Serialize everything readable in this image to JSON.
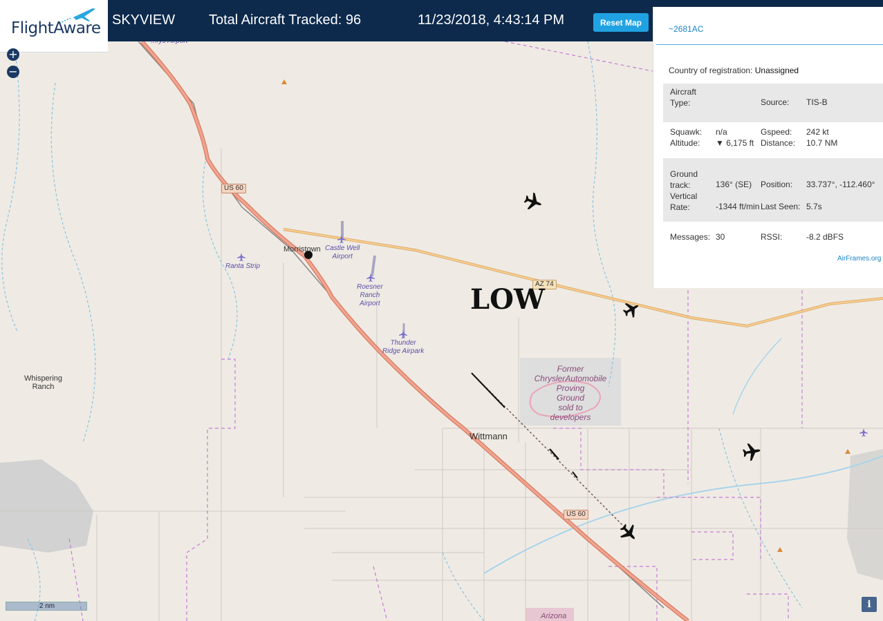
{
  "header": {
    "logo_text": "FlightAware",
    "title": "SKYVIEW",
    "total_aircraft": "Total Aircraft Tracked: 96",
    "datetime": "11/23/2018, 4:43:14 PM",
    "reset_button": "Reset Map"
  },
  "zoom": {
    "in": "+",
    "out": "−"
  },
  "panel": {
    "title": "~2681AC",
    "country_label": "Country of registration:",
    "country_value": "Unassigned",
    "aircraft_type_label": "Aircraft\nType:",
    "source_label": "Source:",
    "source_value": "TIS-B",
    "squawk_label": "Squawk:",
    "squawk_value": "n/a",
    "gspeed_label": "Gspeed:",
    "gspeed_value": "242 kt",
    "altitude_label": "Altitude:",
    "altitude_value": "▼ 6,175 ft",
    "distance_label": "Distance:",
    "distance_value": "10.7 NM",
    "ground_track_label": "Ground\ntrack:",
    "ground_track_value": "136° (SE)",
    "position_label": "Position:",
    "position_value": "33.737°, -112.460°",
    "vertical_rate_label": "Vertical\nRate:",
    "vertical_rate_value": "-1344 ft/min",
    "last_seen_label": "Last Seen:",
    "last_seen_value": "5.7s",
    "messages_label": "Messages:",
    "messages_value": "30",
    "rssi_label": "RSSI:",
    "rssi_value": "-8.2 dBFS",
    "airframes_link": "AirFrames.org"
  },
  "map": {
    "low_label": "LOW",
    "places": {
      "morristown": "Morristown",
      "whispering_ranch": "Whispering\nRanch",
      "wittmann": "Wittmann",
      "former_chrysler": "Former\nChryslerAutomobile\nProving\nGround\nsold to\ndevelopers",
      "arizona": "Arizona",
      "airport_top": "...rys Airport"
    },
    "airports": {
      "ranta": "Ranta Strip",
      "castle_well": "Castle Well\nAirport",
      "roesner": "Roesner\nRanch\nAirport",
      "thunder_ridge": "Thunder\nRidge Airpark"
    },
    "roads": {
      "us60_a": "US 60",
      "us60_b": "US 60",
      "az74": "AZ 74"
    },
    "scale": "2 nm"
  },
  "colors": {
    "header_bg": "#0d2a4c",
    "accent": "#20a2e2",
    "highway": "#e8896f",
    "state_road": "#f0b36a",
    "boundary": "#c77ad6",
    "water": "#8fc6e3"
  },
  "icons": [
    "plane-icon",
    "airport-icon",
    "zoom-in-icon",
    "zoom-out-icon",
    "info-icon",
    "peak-icon"
  ]
}
